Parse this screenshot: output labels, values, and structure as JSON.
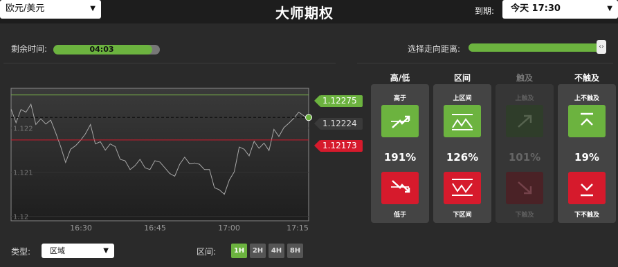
{
  "header": {
    "asset": "欧元/美元",
    "title": "大师期权",
    "expiry_label": "到期:",
    "expiry_value": "今天 17:30"
  },
  "timer": {
    "label": "剩余时间:",
    "value": "04:03",
    "progress": 0.93
  },
  "distance": {
    "label": "选择走向距离:",
    "level": 1.0
  },
  "prices": {
    "upper": "1.12275",
    "current": "1.12224",
    "lower": "1.12173"
  },
  "chart_data": {
    "type": "line",
    "y_ticks": [
      "1.122",
      "1.121",
      "1.12"
    ],
    "x_ticks": [
      "16:30",
      "16:45",
      "17:00",
      "17:15"
    ],
    "ylim": [
      1.1199,
      1.1229
    ],
    "upper_barrier": 1.12275,
    "lower_barrier": 1.12173,
    "current": 1.12224,
    "series": [
      {
        "x": [
          0,
          1,
          2,
          3,
          4,
          5,
          6,
          7,
          8,
          9,
          10,
          11,
          12,
          13,
          14,
          15,
          16,
          17,
          18,
          19,
          20,
          21,
          22,
          23,
          24,
          25,
          26,
          27,
          28,
          29,
          30,
          31,
          32,
          33,
          34,
          35,
          36,
          37,
          38,
          39,
          40,
          41,
          42,
          43,
          44,
          45,
          46,
          47,
          48,
          49,
          50,
          51,
          52,
          53,
          54,
          55,
          56,
          57,
          58,
          59,
          60
        ],
        "y": [
          1.12243,
          1.12212,
          1.12242,
          1.12236,
          1.12254,
          1.12208,
          1.12221,
          1.12209,
          1.12218,
          1.12189,
          1.12158,
          1.12122,
          1.12152,
          1.1216,
          1.12172,
          1.12187,
          1.12208,
          1.12164,
          1.12169,
          1.1215,
          1.12164,
          1.12158,
          1.12129,
          1.12126,
          1.12106,
          1.12115,
          1.12129,
          1.1211,
          1.12106,
          1.12126,
          1.12123,
          1.1211,
          1.12097,
          1.12091,
          1.12118,
          1.12134,
          1.12119,
          1.12121,
          1.12118,
          1.12106,
          1.12106,
          1.12065,
          1.1206,
          1.1205,
          1.12082,
          1.12101,
          1.12157,
          1.12152,
          1.12137,
          1.1217,
          1.12154,
          1.12166,
          1.12149,
          1.12197,
          1.12181,
          1.12201,
          1.12211,
          1.12222,
          1.12236,
          1.12228,
          1.12219
        ]
      }
    ]
  },
  "controls": {
    "type_label": "类型:",
    "type_value": "区域",
    "range_label": "区间:",
    "ranges": [
      "1H",
      "2H",
      "4H",
      "8H"
    ]
  },
  "trade_columns": [
    {
      "head": "高/低",
      "up_label": "高于",
      "payout": "191%",
      "down_label": "低于"
    },
    {
      "head": "区间",
      "up_label": "上区间",
      "payout": "126%",
      "down_label": "下区间"
    },
    {
      "head": "触及",
      "up_label": "上触及",
      "payout": "101%",
      "down_label": "下触及"
    },
    {
      "head": "不触及",
      "up_label": "上不触及",
      "payout": "19%",
      "down_label": "下不触及"
    }
  ],
  "colors": {
    "accent_green": "#6cb33f",
    "accent_red": "#d61a2c",
    "background": "#2a2a2a"
  }
}
